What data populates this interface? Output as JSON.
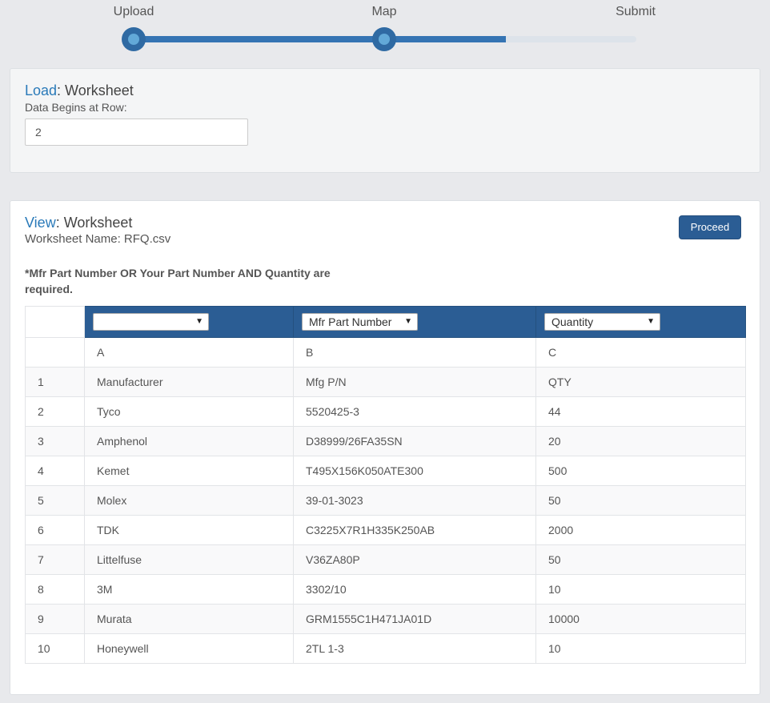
{
  "stepper": {
    "steps": [
      {
        "label": "Upload"
      },
      {
        "label": "Map"
      },
      {
        "label": "Submit"
      }
    ],
    "progress": 0.74
  },
  "load_panel": {
    "title_accent": "Load",
    "title_rest": ": Worksheet",
    "row_label": "Data Begins at Row:",
    "row_value": "2"
  },
  "view_panel": {
    "title_accent": "View",
    "title_rest": ": Worksheet",
    "worksheet_name": "Worksheet Name: RFQ.csv",
    "proceed_label": "Proceed",
    "required_note": "*Mfr Part Number OR Your Part Number AND Quantity are required.",
    "mapping_selects": [
      {
        "value": ""
      },
      {
        "value": "Mfr Part Number"
      },
      {
        "value": "Quantity"
      }
    ],
    "column_letters": [
      "A",
      "B",
      "C"
    ],
    "rows": [
      {
        "num": "1",
        "a": "Manufacturer",
        "b": "Mfg P/N",
        "c": "QTY"
      },
      {
        "num": "2",
        "a": "Tyco",
        "b": "5520425-3",
        "c": "44"
      },
      {
        "num": "3",
        "a": "Amphenol",
        "b": "D38999/26FA35SN",
        "c": "20"
      },
      {
        "num": "4",
        "a": "Kemet",
        "b": "T495X156K050ATE300",
        "c": "500"
      },
      {
        "num": "5",
        "a": "Molex",
        "b": "39-01-3023",
        "c": "50"
      },
      {
        "num": "6",
        "a": "TDK",
        "b": "C3225X7R1H335K250AB",
        "c": "2000"
      },
      {
        "num": "7",
        "a": "Littelfuse",
        "b": "V36ZA80P",
        "c": "50"
      },
      {
        "num": "8",
        "a": "3M",
        "b": "3302/10",
        "c": "10"
      },
      {
        "num": "9",
        "a": "Murata",
        "b": "GRM1555C1H471JA01D",
        "c": "10000"
      },
      {
        "num": "10",
        "a": "Honeywell",
        "b": "2TL 1-3",
        "c": "10"
      }
    ]
  },
  "colors": {
    "accent": "#2a7ab9",
    "header_blue": "#2b5d94",
    "track_fill": "#3574b3"
  }
}
